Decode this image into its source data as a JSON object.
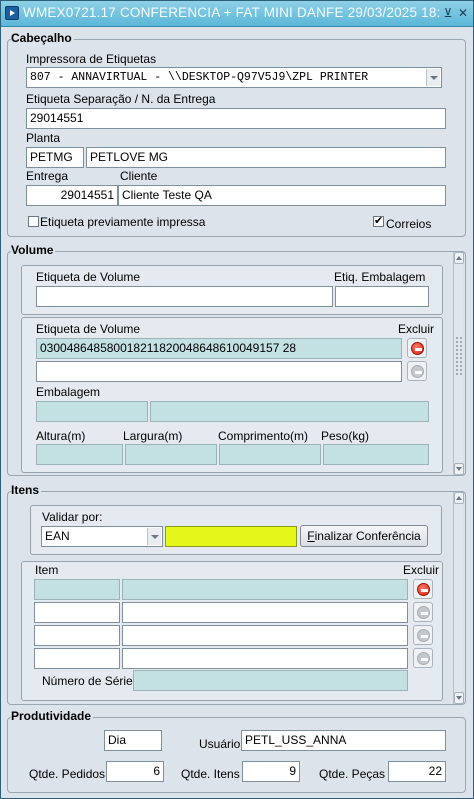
{
  "window": {
    "title": "WMEX0721.17    CONFERENCIA + FAT MINI DANFE     29/03/2025 18:"
  },
  "cabecalho": {
    "section_label": "Cabeçalho",
    "impressora_label": "Impressora de Etiquetas",
    "impressora_value": "807 - ANNAVIRTUAL      - \\\\DESKTOP-Q97V5J9\\ZPL PRINTER",
    "etiqueta_label": "Etiqueta Separação / N. da Entrega",
    "etiqueta_value": "29014551",
    "planta_label": "Planta",
    "planta_code": "PETMG",
    "planta_name": "PETLOVE MG",
    "entrega_label": "Entrega",
    "entrega_value": "29014551",
    "cliente_label": "Cliente",
    "cliente_value": "Cliente Teste QA",
    "previamente_label": "Etiqueta previamente impressa",
    "previamente_checked": false,
    "correios_label": "Correios",
    "correios_checked": true
  },
  "volume": {
    "section_label": "Volume",
    "etiqueta_volume_label": "Etiqueta de Volume",
    "etiqueta_volume_value": "",
    "etiq_embalagem_label": "Etiq. Embalagem",
    "etiq_embalagem_value": "",
    "list_header_label": "Etiqueta de Volume",
    "excluir_label": "Excluir",
    "rows": [
      {
        "value": "030048648580018211820048648610049157 28",
        "delete_active": true
      },
      {
        "value": "",
        "delete_active": false
      }
    ],
    "embalagem_label": "Embalagem",
    "altura_label": "Altura(m)",
    "largura_label": "Largura(m)",
    "comprimento_label": "Comprimento(m)",
    "peso_label": "Peso(kg)"
  },
  "itens": {
    "section_label": "Itens",
    "validar_label": "Validar por:",
    "validar_value": "EAN",
    "finalizar_label": "Finalizar Conferência",
    "item_label": "Item",
    "excluir_label": "Excluir",
    "numero_serie_label": "Número de Série"
  },
  "produtividade": {
    "section_label": "Produtividade",
    "dia_value": "Dia",
    "usuario_label": "Usuário",
    "usuario_value": "PETL_USS_ANNA",
    "pedidos_label": "Qtde. Pedidos",
    "pedidos_value": "6",
    "itens_label": "Qtde. Itens",
    "itens_value": "9",
    "pecas_label": "Qtde. Peças",
    "pecas_value": "22"
  }
}
